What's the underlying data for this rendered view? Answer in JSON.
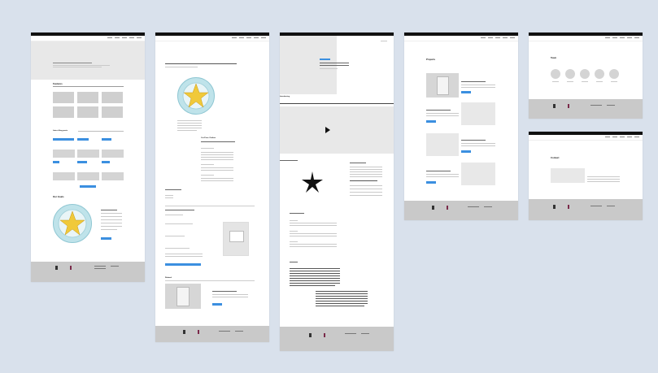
{
  "canvas": {
    "background": "#d9e1ec"
  },
  "colors": {
    "accent": "#3b8fe0",
    "placeholder": "#e8e8e8",
    "footer": "#c9c9c9",
    "topbar": "#111111"
  },
  "frames": {
    "home": {
      "sections": {
        "features": "Features",
        "latest": "Latest blog posts",
        "about": "Our Goals"
      },
      "about_button": "Learn more"
    },
    "article": {
      "callout": "Cut Price Clothes",
      "footer_heading": "Related"
    },
    "video": {
      "intro_label": "Introducing",
      "play_icon": "play-icon",
      "section_video": "Video",
      "section_quote": "Quote"
    },
    "blog": {
      "heading": "Projects"
    },
    "team": {
      "heading": "Team"
    },
    "contact": {
      "heading": "Contact"
    }
  }
}
